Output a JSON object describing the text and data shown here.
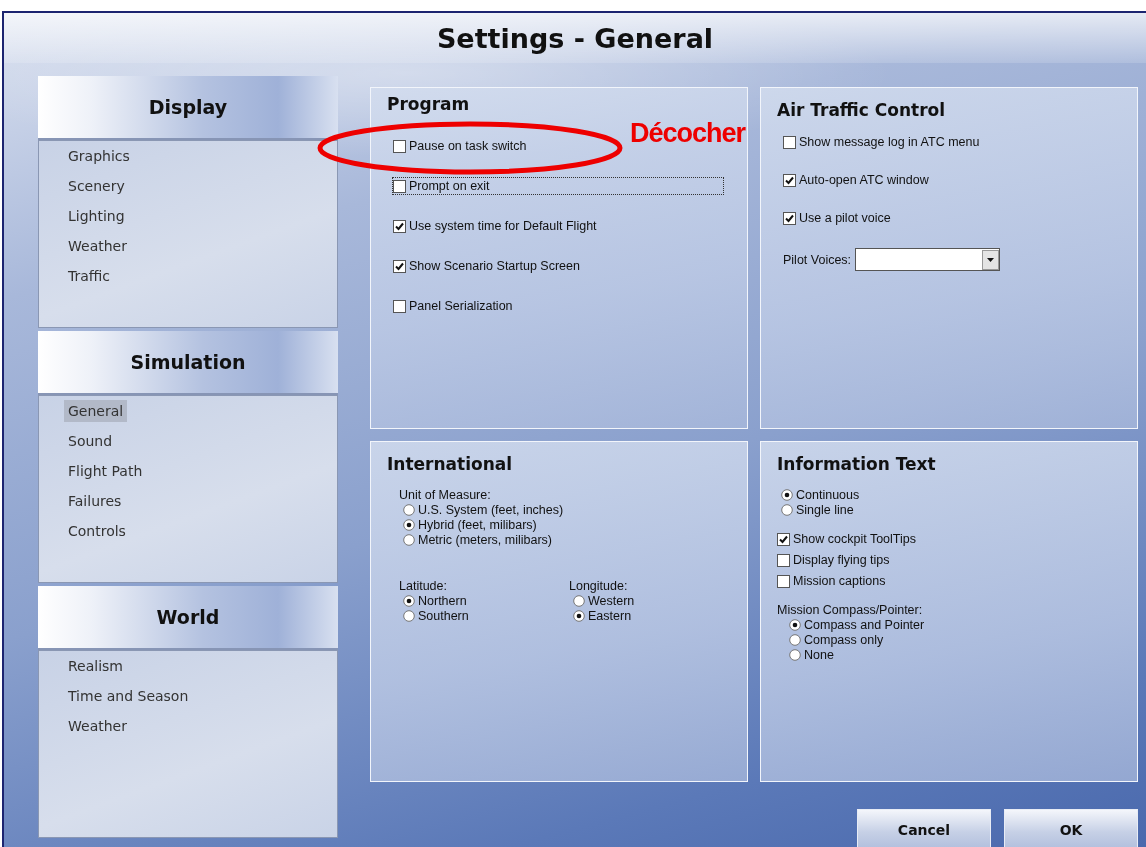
{
  "window": {
    "title": "Settings - General"
  },
  "sidebar": [
    {
      "title": "Display",
      "items": [
        {
          "label": "Graphics",
          "selected": false
        },
        {
          "label": "Scenery",
          "selected": false
        },
        {
          "label": "Lighting",
          "selected": false
        },
        {
          "label": "Weather",
          "selected": false
        },
        {
          "label": "Traffic",
          "selected": false
        }
      ]
    },
    {
      "title": "Simulation",
      "items": [
        {
          "label": "General",
          "selected": true
        },
        {
          "label": "Sound",
          "selected": false
        },
        {
          "label": "Flight Path",
          "selected": false
        },
        {
          "label": "Failures",
          "selected": false
        },
        {
          "label": "Controls",
          "selected": false
        }
      ]
    },
    {
      "title": "World",
      "items": [
        {
          "label": "Realism",
          "selected": false
        },
        {
          "label": "Time and Season",
          "selected": false
        },
        {
          "label": "Weather",
          "selected": false
        }
      ]
    }
  ],
  "program": {
    "title": "Program",
    "options": [
      {
        "label": "Pause on task switch",
        "checked": false,
        "focused": false
      },
      {
        "label": "Prompt on exit",
        "checked": false,
        "focused": true
      },
      {
        "label": "Use system time for Default Flight",
        "checked": true,
        "focused": false
      },
      {
        "label": "Show Scenario Startup Screen",
        "checked": true,
        "focused": false
      },
      {
        "label": "Panel Serialization",
        "checked": false,
        "focused": false
      }
    ]
  },
  "air_traffic_control": {
    "title": "Air Traffic Control",
    "options": [
      {
        "label": "Show message log in ATC menu",
        "checked": false
      },
      {
        "label": "Auto-open ATC window",
        "checked": true
      },
      {
        "label": "Use a pilot voice",
        "checked": true
      }
    ],
    "pilot_voices": {
      "label": "Pilot Voices:"
    }
  },
  "international": {
    "title": "International",
    "unit_of_measure": {
      "label": "Unit of Measure:",
      "options": [
        {
          "label": "U.S. System (feet, inches)",
          "selected": false
        },
        {
          "label": "Hybrid (feet, milibars)",
          "selected": true
        },
        {
          "label": "Metric (meters, milibars)",
          "selected": false
        }
      ]
    },
    "latitude": {
      "label": "Latitude:",
      "options": [
        {
          "label": "Northern",
          "selected": true
        },
        {
          "label": "Southern",
          "selected": false
        }
      ]
    },
    "longitude": {
      "label": "Longitude:",
      "options": [
        {
          "label": "Western",
          "selected": false
        },
        {
          "label": "Eastern",
          "selected": true
        }
      ]
    }
  },
  "information_text": {
    "title": "Information Text",
    "display_mode": [
      {
        "label": "Continuous",
        "selected": true
      },
      {
        "label": "Single line",
        "selected": false
      }
    ],
    "options": [
      {
        "label": "Show cockpit ToolTips",
        "checked": true
      },
      {
        "label": "Display flying tips",
        "checked": false
      },
      {
        "label": "Mission captions",
        "checked": false
      }
    ],
    "mission_compass": {
      "label": "Mission Compass/Pointer:",
      "options": [
        {
          "label": "Compass and Pointer",
          "selected": true
        },
        {
          "label": "Compass only",
          "selected": false
        },
        {
          "label": "None",
          "selected": false
        }
      ]
    }
  },
  "buttons": [
    {
      "label": "Cancel"
    },
    {
      "label": "OK"
    }
  ],
  "annotation": {
    "text": "Décocher"
  }
}
